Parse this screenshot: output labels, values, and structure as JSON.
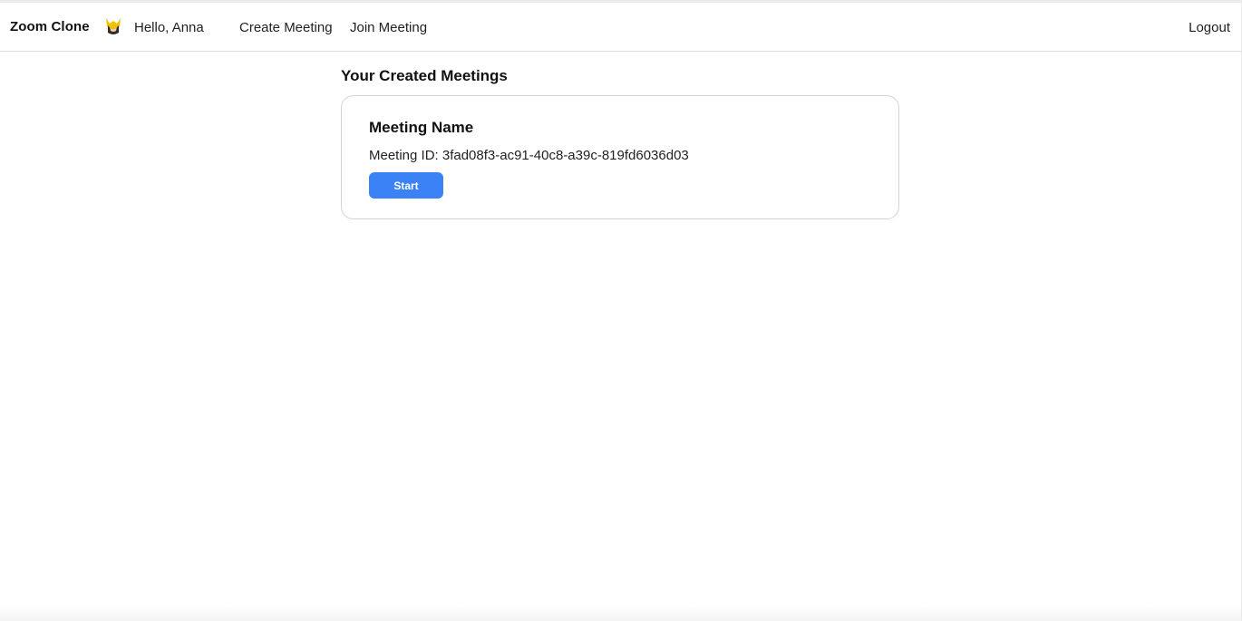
{
  "navbar": {
    "brand": "Zoom Clone",
    "avatar_icon": "wolverine-avatar-icon",
    "greeting": "Hello, Anna",
    "links": [
      {
        "label": "Create Meeting"
      },
      {
        "label": "Join Meeting"
      }
    ],
    "logout_label": "Logout"
  },
  "main": {
    "section_title": "Your Created Meetings",
    "meetings": [
      {
        "name": "Meeting Name",
        "id_text": "Meeting ID: 3fad08f3-ac91-40c8-a39c-819fd6036d03",
        "start_label": "Start"
      }
    ]
  },
  "colors": {
    "primary_button": "#3b82f6",
    "border": "#d3d3d3",
    "text": "#111111"
  }
}
